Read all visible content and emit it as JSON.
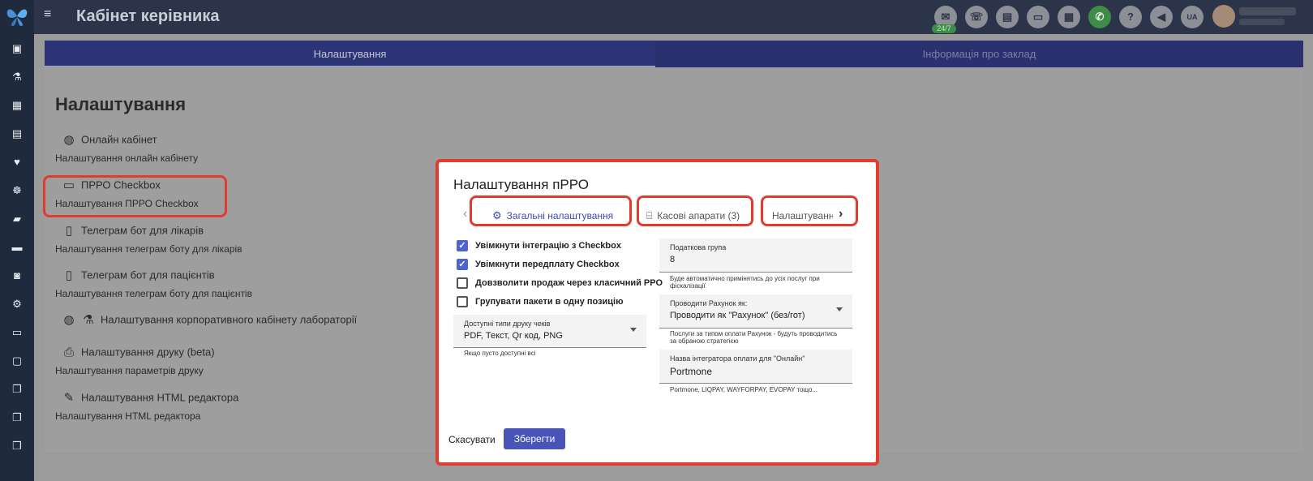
{
  "app": {
    "title": "Кабінет керівника"
  },
  "topbar": {
    "badge_247": "24/7",
    "lang": "UA"
  },
  "tabs": [
    {
      "label": "Налаштування",
      "active": true
    },
    {
      "label": "Інформація про заклад",
      "active": false
    }
  ],
  "settings": {
    "heading": "Налаштування",
    "items": [
      {
        "title": "Онлайн кабінет",
        "subtitle": "Налаштування онлайн кабінету",
        "icon": "globe-icon"
      },
      {
        "title": "ПРРО Checkbox",
        "subtitle": "Налаштування ПРРО Checkbox",
        "icon": "card-icon"
      },
      {
        "title": "Телеграм бот для лікарів",
        "subtitle": "Налаштування телеграм боту для лікарів",
        "icon": "phone-check-icon"
      },
      {
        "title": "Телеграм бот для пацієнтів",
        "subtitle": "Налаштування телеграм боту для пацієнтів",
        "icon": "phone-check-icon"
      },
      {
        "title": "Налаштування корпоративного кабінету лабораторії",
        "subtitle": "",
        "icon": "globe-flask-icon"
      },
      {
        "title": "Налаштування друку (beta)",
        "subtitle": "Налаштування параметрів друку",
        "icon": "printer-icon"
      },
      {
        "title": "Налаштування HTML редактора",
        "subtitle": "Налаштування HTML редактора",
        "icon": "pencil-icon"
      }
    ]
  },
  "dialog": {
    "title": "Налаштування пРРО",
    "tabs": [
      {
        "label": "Загальні налаштування",
        "active": true
      },
      {
        "label": "Касові апарати (3)",
        "active": false
      },
      {
        "label": "Налаштуванн",
        "active": false
      }
    ],
    "checkboxes": [
      {
        "label": "Увімкнути інтеграцію з Checkbox",
        "checked": true
      },
      {
        "label": "Увімкнути передплату Checkbox",
        "checked": true
      },
      {
        "label": "Довзволити продаж через класичний РРО",
        "checked": false
      },
      {
        "label": "Групувати пакети в одну позицію",
        "checked": false
      }
    ],
    "print_types": {
      "label": "Доступні типи друку чеків",
      "value": "PDF, Текст, Qr код, PNG",
      "hint": "Якщо пусто доступні всі"
    },
    "tax_group": {
      "label": "Податкова група",
      "value": "8",
      "hint": "Буде автоматично примінятись до усіх послуг при фіскалізації"
    },
    "invoice_mode": {
      "label": "Проводити Рахунок як:",
      "value": "Проводити як \"Рахунок\" (без/гот)",
      "hint": "Послуги за типом оплати Рахунок - будуть проводитись за обраною стратегією"
    },
    "integrator": {
      "label": "Назва інтегратора оплати для \"Онлайн\"",
      "value": "Portmone",
      "hint": "Portmone, LIQPAY, WAYFORPAY, EVOPAY тощо..."
    },
    "cancel_label": "Скасувати",
    "save_label": "Зберегти"
  },
  "colors": {
    "highlight": "#e23b30",
    "accent": "#4854b8",
    "topbar": "#2c3449",
    "rail": "#1f2a3d"
  }
}
